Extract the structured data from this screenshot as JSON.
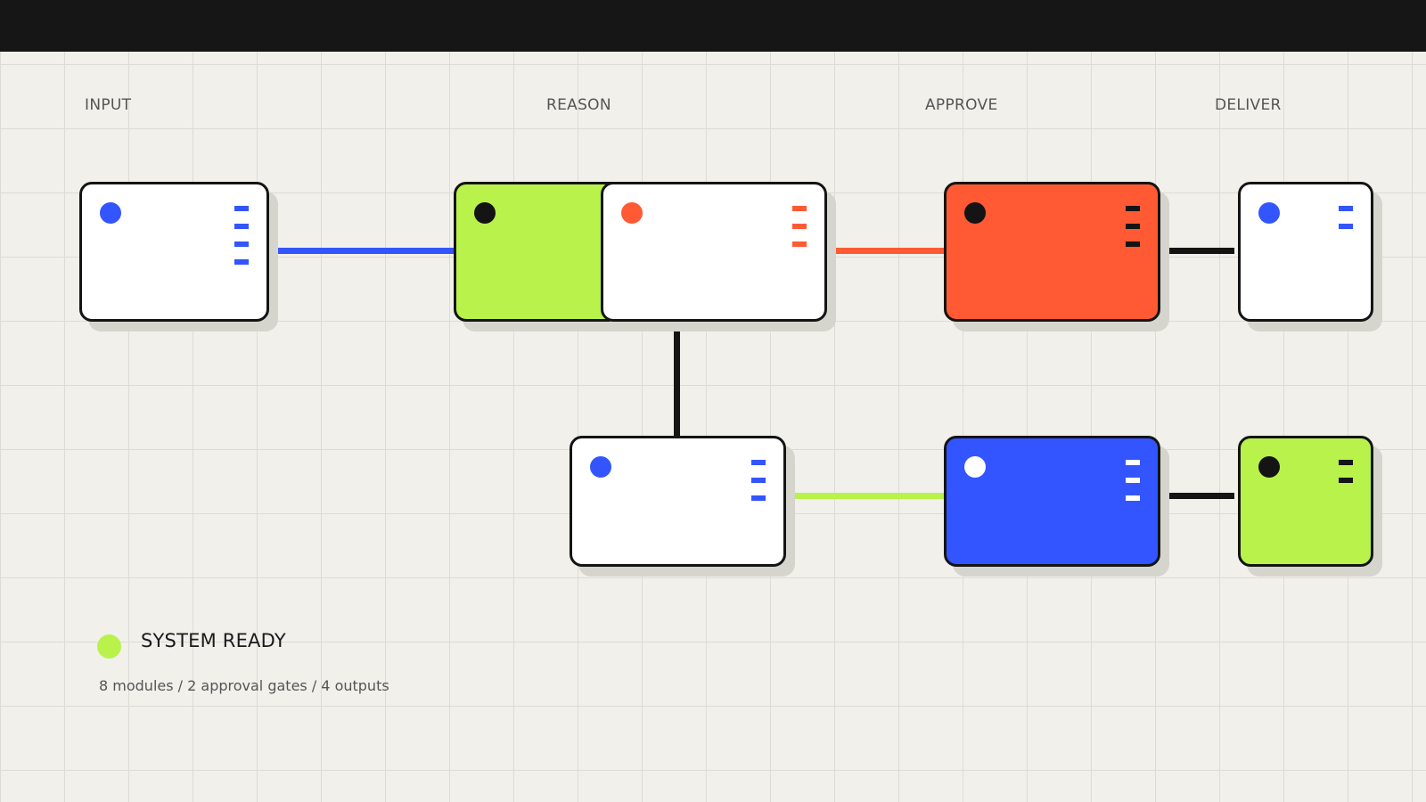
{
  "stages": [
    "INPUT",
    "REASON",
    "APPROVE",
    "DELIVER"
  ],
  "status": {
    "label": "SYSTEM READY",
    "summary": "8 modules / 2 approval gates / 4 outputs"
  },
  "colors": {
    "background": "#f1f0eb",
    "grid": "#dcdbd5",
    "topbar": "#161616",
    "ink": "#141414",
    "blue": "#3355ff",
    "lime": "#b8f24a",
    "orange": "#ff5a33",
    "white": "#ffffff",
    "shadow": "#d6d5cd"
  },
  "nodes": [
    {
      "id": "input",
      "fill": "white",
      "dot": "blue",
      "bars": 4,
      "bar_color": "blue"
    },
    {
      "id": "reason-back",
      "fill": "lime",
      "dot": "ink",
      "bars": 0,
      "bar_color": "ink"
    },
    {
      "id": "reason-front",
      "fill": "white",
      "dot": "orange",
      "bars": 3,
      "bar_color": "orange"
    },
    {
      "id": "approve",
      "fill": "orange",
      "dot": "ink",
      "bars": 3,
      "bar_color": "ink"
    },
    {
      "id": "deliver-top",
      "fill": "white",
      "dot": "blue",
      "bars": 2,
      "bar_color": "blue"
    },
    {
      "id": "reason-lower",
      "fill": "white",
      "dot": "blue",
      "bars": 3,
      "bar_color": "blue"
    },
    {
      "id": "approve-lower",
      "fill": "blue",
      "dot": "white",
      "bars": 3,
      "bar_color": "white"
    },
    {
      "id": "deliver-bottom",
      "fill": "lime",
      "dot": "ink",
      "bars": 2,
      "bar_color": "ink"
    }
  ],
  "connectors": [
    {
      "id": "input-to-reason",
      "color": "blue"
    },
    {
      "id": "reason-to-approve",
      "color": "orange"
    },
    {
      "id": "approve-to-deliver",
      "color": "ink"
    },
    {
      "id": "reason-to-lower",
      "color": "ink"
    },
    {
      "id": "lower-to-approve",
      "color": "lime"
    },
    {
      "id": "approve-lower-to-deliver",
      "color": "ink"
    }
  ]
}
